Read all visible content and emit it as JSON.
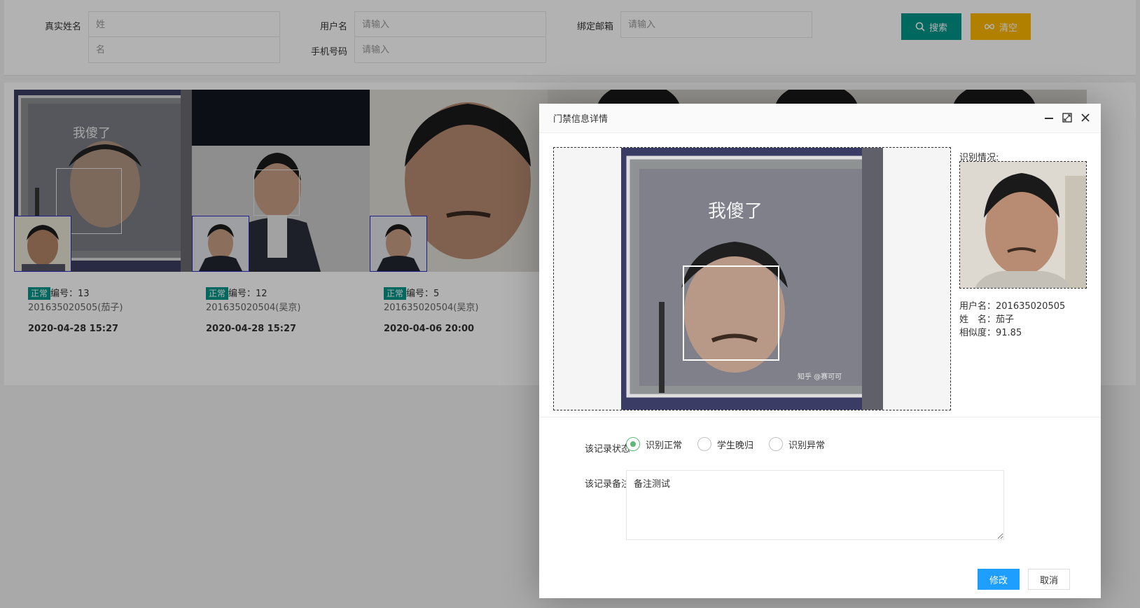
{
  "search": {
    "realname_label": "真实姓名",
    "surname_placeholder": "姓",
    "givenname_placeholder": "名",
    "username_label": "用户名",
    "username_placeholder": "请输入",
    "phone_label": "手机号码",
    "phone_placeholder": "请输入",
    "email_label": "绑定邮箱",
    "email_placeholder": "请输入",
    "search_button": "搜索",
    "clear_button": "清空"
  },
  "cards": [
    {
      "status": "正常",
      "number": "编号：13",
      "user": "201635020505(茄子)",
      "time": "2020-04-28 15:27",
      "overlay_text": "我傻了"
    },
    {
      "status": "正常",
      "number": "编号：12",
      "user": "201635020504(吴京)",
      "time": "2020-04-28 15:27"
    },
    {
      "status": "正常",
      "number": "编号：5",
      "user": "201635020504(吴京)",
      "time": "2020-04-06 20:00"
    }
  ],
  "modal": {
    "title": "门禁信息详情",
    "photo_overlay_text": "我傻了",
    "photo_watermark": "知乎 @赛可可",
    "recognition_title": "识别情况:",
    "username_line": "用户名：201635020505",
    "name_line": "姓　名：茄子",
    "similarity_line": "相似度：91.85",
    "status_label": "该记录状态",
    "status_options": [
      "识别正常",
      "学生晚归",
      "识别异常"
    ],
    "status_selected": "识别正常",
    "remark_label": "该记录备注",
    "remark_value": "备注测试",
    "confirm_button": "修改",
    "cancel_button": "取消"
  },
  "colors": {
    "primary": "#009688",
    "warning": "#ffb800",
    "blue": "#1e9fff",
    "radio_checked": "#5fb878"
  }
}
